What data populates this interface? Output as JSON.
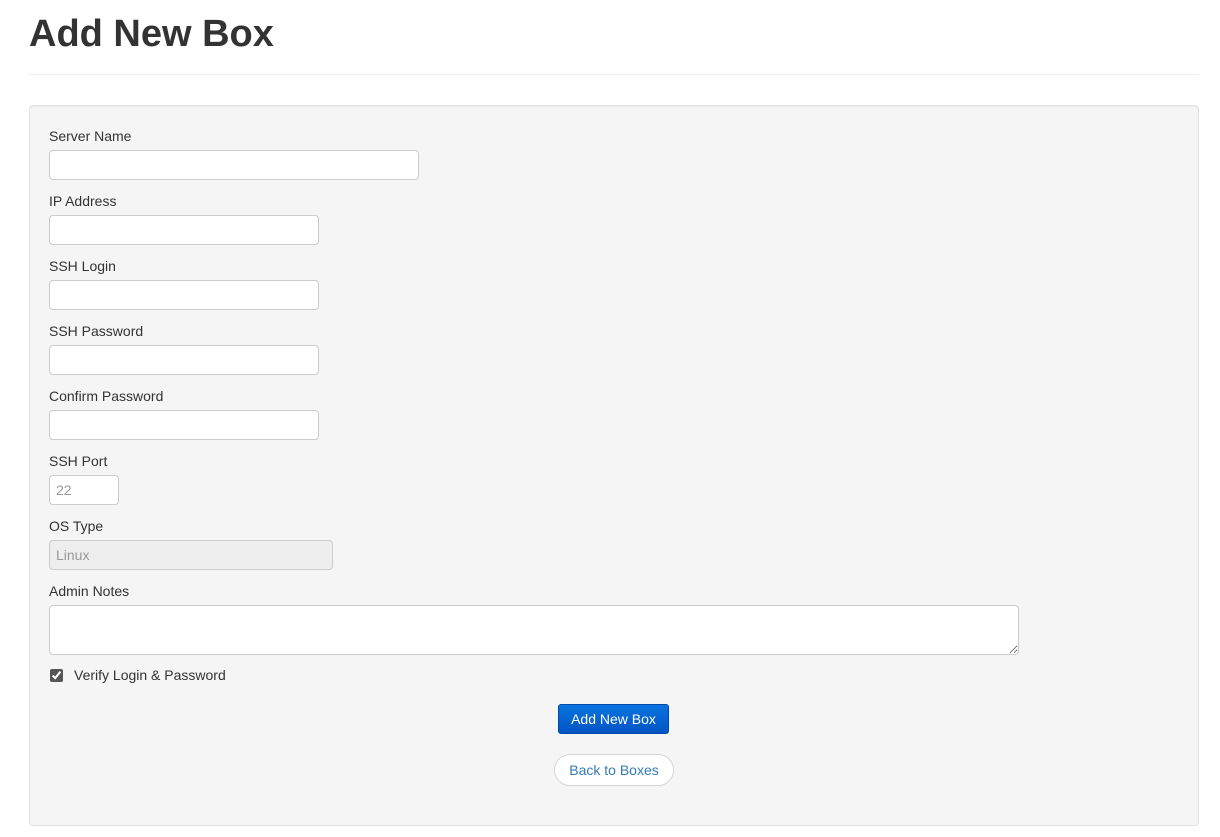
{
  "page": {
    "title": "Add New Box"
  },
  "form": {
    "server_name": {
      "label": "Server Name",
      "value": "",
      "placeholder": ""
    },
    "ip_address": {
      "label": "IP Address",
      "value": "",
      "placeholder": ""
    },
    "ssh_login": {
      "label": "SSH Login",
      "value": "",
      "placeholder": ""
    },
    "ssh_password": {
      "label": "SSH Password",
      "value": "",
      "placeholder": ""
    },
    "confirm_password": {
      "label": "Confirm Password",
      "value": "",
      "placeholder": ""
    },
    "ssh_port": {
      "label": "SSH Port",
      "value": "",
      "placeholder": "22"
    },
    "os_type": {
      "label": "OS Type",
      "value": "Linux",
      "disabled": true
    },
    "admin_notes": {
      "label": "Admin Notes",
      "value": ""
    },
    "verify": {
      "label": "Verify Login & Password",
      "checked": true
    }
  },
  "buttons": {
    "submit_label": "Add New Box",
    "back_label": "Back to Boxes"
  },
  "colors": {
    "primary": "#0062cc",
    "link": "#337ab7",
    "well_bg": "#f5f5f5"
  }
}
